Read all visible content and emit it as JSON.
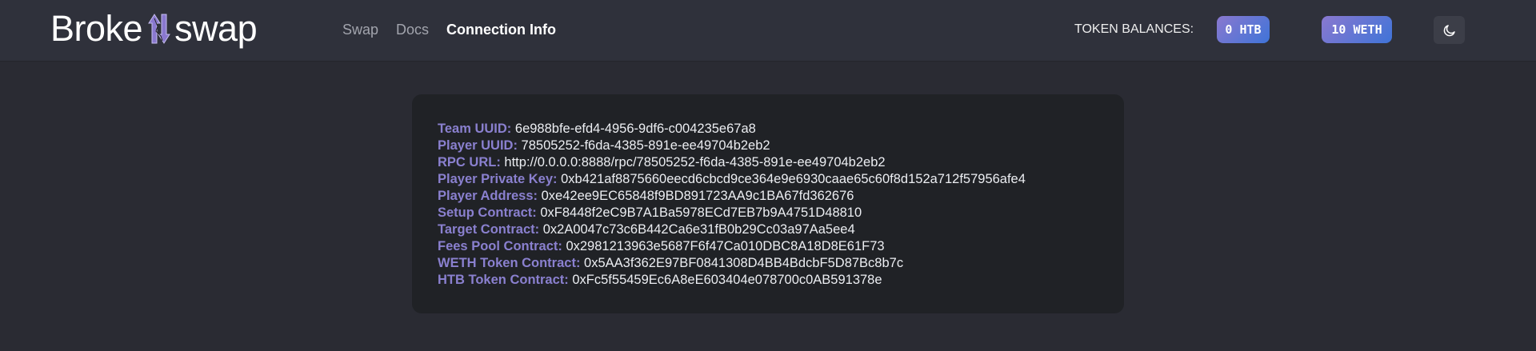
{
  "header": {
    "logo": {
      "left": "Broke",
      "right": "swap"
    },
    "nav": [
      {
        "label": "Swap",
        "active": false
      },
      {
        "label": "Docs",
        "active": false
      },
      {
        "label": "Connection Info",
        "active": true
      }
    ],
    "token_balances_label": "TOKEN BALANCES:",
    "balances": [
      {
        "label": "0 HTB"
      },
      {
        "label": "10 WETH"
      }
    ],
    "theme_icon": "moon-icon",
    "accent": "#8a80cf"
  },
  "connection": [
    {
      "label": "Team UUID:",
      "value": "6e988bfe-efd4-4956-9df6-c004235e67a8"
    },
    {
      "label": "Player UUID:",
      "value": "78505252-f6da-4385-891e-ee49704b2eb2"
    },
    {
      "label": "RPC URL:",
      "value": "http://0.0.0.0:8888/rpc/78505252-f6da-4385-891e-ee49704b2eb2"
    },
    {
      "label": "Player Private Key:",
      "value": "0xb421af8875660eecd6cbcd9ce364e9e6930caae65c60f8d152a712f57956afe4"
    },
    {
      "label": "Player Address:",
      "value": "0xe42ee9EC65848f9BD891723AA9c1BA67fd362676"
    },
    {
      "label": "Setup Contract:",
      "value": "0xF8448f2eC9B7A1Ba5978ECd7EB7b9A4751D48810"
    },
    {
      "label": "Target Contract:",
      "value": "0x2A0047c73c6B442Ca6e31fB0b29Cc03a97Aa5ee4"
    },
    {
      "label": "Fees Pool Contract:",
      "value": "0x2981213963e5687F6f47Ca010DBC8A18D8E61F73"
    },
    {
      "label": "WETH Token Contract:",
      "value": "0x5AA3f362E97BF0841308D4BB4BdcbF5D87Bc8b7c"
    },
    {
      "label": "HTB Token Contract:",
      "value": "0xFc5f55459Ec6A8eE603404e078700c0AB591378e"
    }
  ]
}
